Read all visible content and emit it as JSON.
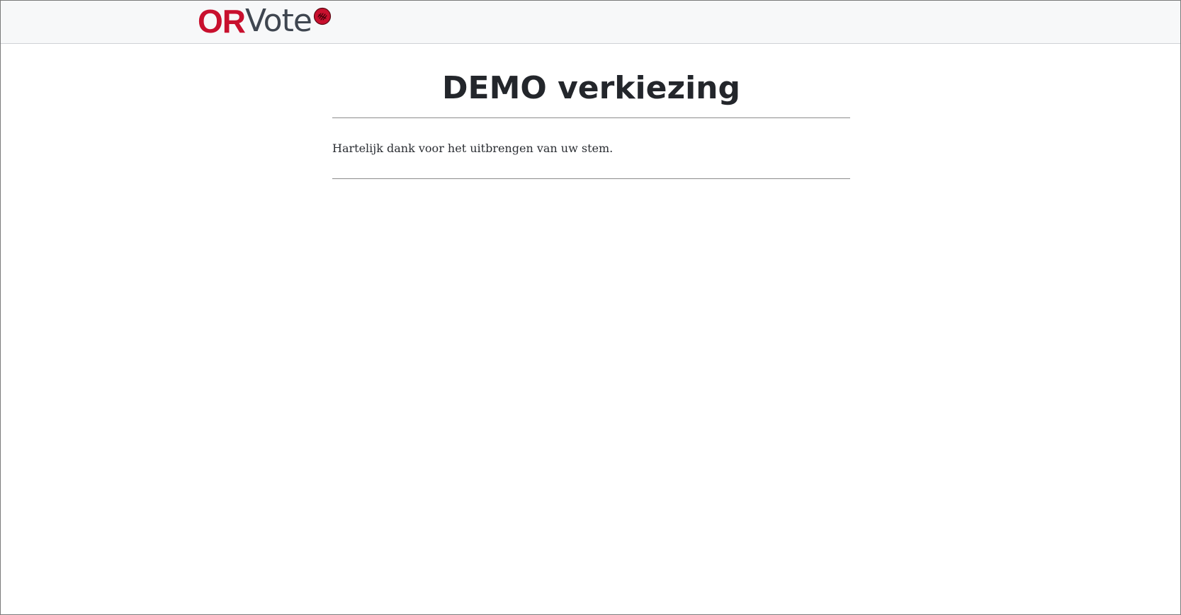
{
  "header": {
    "logo_part1": "OR",
    "logo_part2": "Vote",
    "logo_mark_icon": "ballot-seal-icon",
    "brand_red": "#c8102e",
    "brand_grey": "#3f4650"
  },
  "main": {
    "title": "DEMO verkiezing",
    "message": "Hartelijk dank voor het uitbrengen van uw stem."
  }
}
